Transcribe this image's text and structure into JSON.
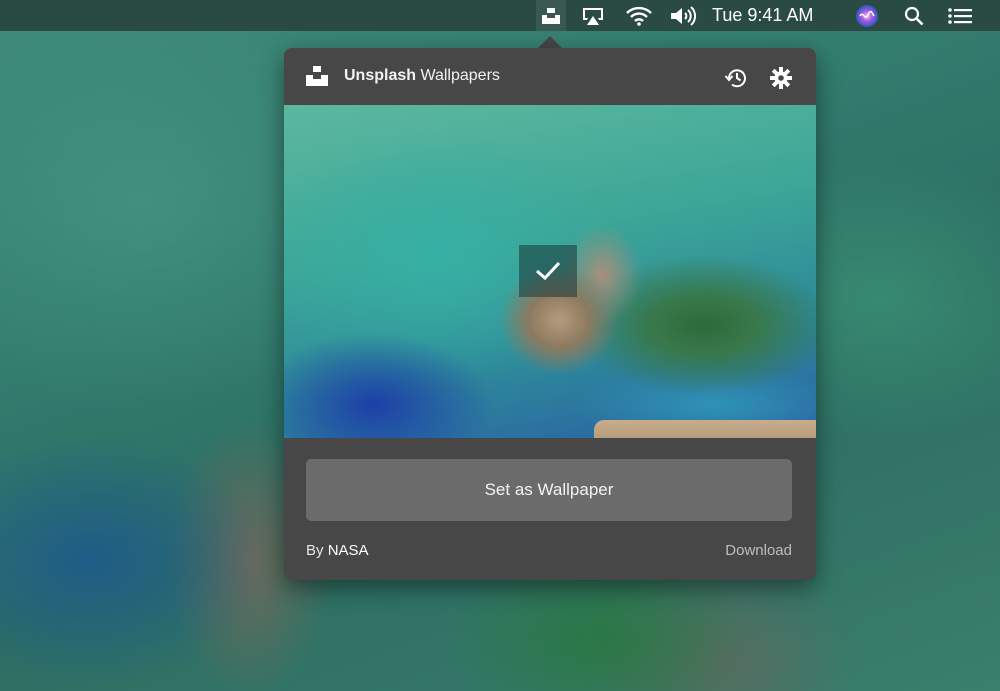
{
  "menubar": {
    "clock": "Tue 9:41 AM",
    "icons": [
      "unsplash-icon",
      "airplay-icon",
      "wifi-icon",
      "volume-icon",
      "siri-icon",
      "search-icon",
      "list-icon"
    ]
  },
  "popover": {
    "app_name_bold": "Unsplash",
    "app_name_rest": " Wallpapers",
    "history_icon": "history-icon",
    "settings_icon": "gear-icon",
    "set_wallpaper_label": "Set as Wallpaper",
    "credit_prefix": "By ",
    "credit_author": "NASA",
    "download_label": "Download"
  },
  "colors": {
    "popover_bg": "#474747",
    "button_bg": "#6b6b6b",
    "menubar_bg": "#2a4a44"
  }
}
